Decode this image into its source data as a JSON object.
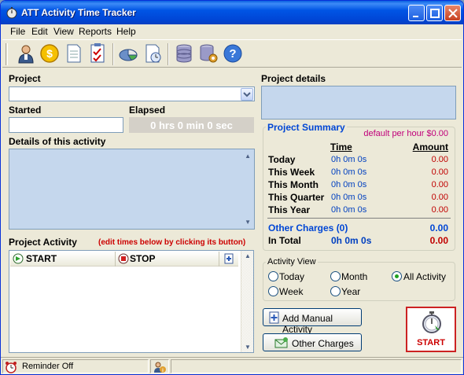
{
  "window": {
    "title": "ATT Activity Time Tracker"
  },
  "menu": [
    "File",
    "Edit",
    "View",
    "Reports",
    "Help"
  ],
  "toolbar_icons": [
    "user-icon",
    "dollar-icon",
    "document-icon",
    "checklist-icon",
    "pie-chart-icon",
    "report-icon",
    "database-icon",
    "database-settings-icon",
    "help-icon"
  ],
  "project": {
    "label": "Project",
    "value": ""
  },
  "started": {
    "label": "Started",
    "value": ""
  },
  "elapsed": {
    "label": "Elapsed",
    "value": "0 hrs 0 min 0 sec"
  },
  "details": {
    "label": "Details of this activity"
  },
  "project_details": {
    "label": "Project details"
  },
  "activity": {
    "label": "Project Activity",
    "hint": "(edit times below by clicking its button)",
    "columns": [
      "START",
      "STOP"
    ]
  },
  "summary": {
    "title": "Project Summary",
    "default_rate": "default per hour $0.00",
    "time_header": "Time",
    "amount_header": "Amount",
    "rows": [
      {
        "label": "Today",
        "time": "0h 0m 0s",
        "amount": "0.00"
      },
      {
        "label": "This Week",
        "time": "0h 0m 0s",
        "amount": "0.00"
      },
      {
        "label": "This Month",
        "time": "0h 0m 0s",
        "amount": "0.00"
      },
      {
        "label": "This Quarter",
        "time": "0h 0m 0s",
        "amount": "0.00"
      },
      {
        "label": "This Year",
        "time": "0h 0m 0s",
        "amount": "0.00"
      }
    ],
    "other_charges_label": "Other Charges (0)",
    "other_charges_amount": "0.00",
    "total_label": "In Total",
    "total_time": "0h 0m 0s",
    "total_amount": "0.00"
  },
  "activity_view": {
    "title": "Activity View",
    "options": [
      "Today",
      "Month",
      "All Activity",
      "Week",
      "Year"
    ],
    "selected": "All Activity"
  },
  "buttons": {
    "add_manual": "Add Manual Activity",
    "other_charges": "Other Charges",
    "start": "START"
  },
  "status": {
    "reminder": "Reminder Off"
  },
  "colors": {
    "title_blue": "#0055e5",
    "summary_blue": "#0046d5",
    "amount_red": "#c00000",
    "rate_magenta": "#c0007a",
    "start_red": "#cc0000"
  }
}
